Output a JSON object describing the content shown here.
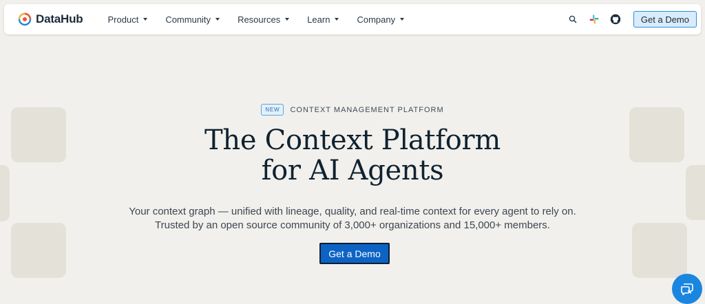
{
  "header": {
    "brand": "DataHub",
    "menu": [
      {
        "label": "Product"
      },
      {
        "label": "Community"
      },
      {
        "label": "Resources"
      },
      {
        "label": "Learn"
      },
      {
        "label": "Company"
      }
    ],
    "icons": [
      "search-icon",
      "slack-icon",
      "github-icon"
    ],
    "cta_label": "Get a Demo"
  },
  "hero": {
    "badge": "NEW",
    "eyebrow": "CONTEXT MANAGEMENT PLATFORM",
    "title_line1": "The Context Platform",
    "title_line2": "for AI Agents",
    "subtitle_line1": "Your context graph — unified with lineage, quality, and real-time context for every agent to rely on.",
    "subtitle_line2": "Trusted by an open source community of 3,000+ organizations and 15,000+ members.",
    "cta_label": "Get a Demo"
  },
  "colors": {
    "background": "#f2f0ec",
    "accent": "#0d63c4",
    "nav_button_bg": "#d8ecfb",
    "title": "#0f2230"
  },
  "widgets": {
    "chat": "chat-icon"
  }
}
